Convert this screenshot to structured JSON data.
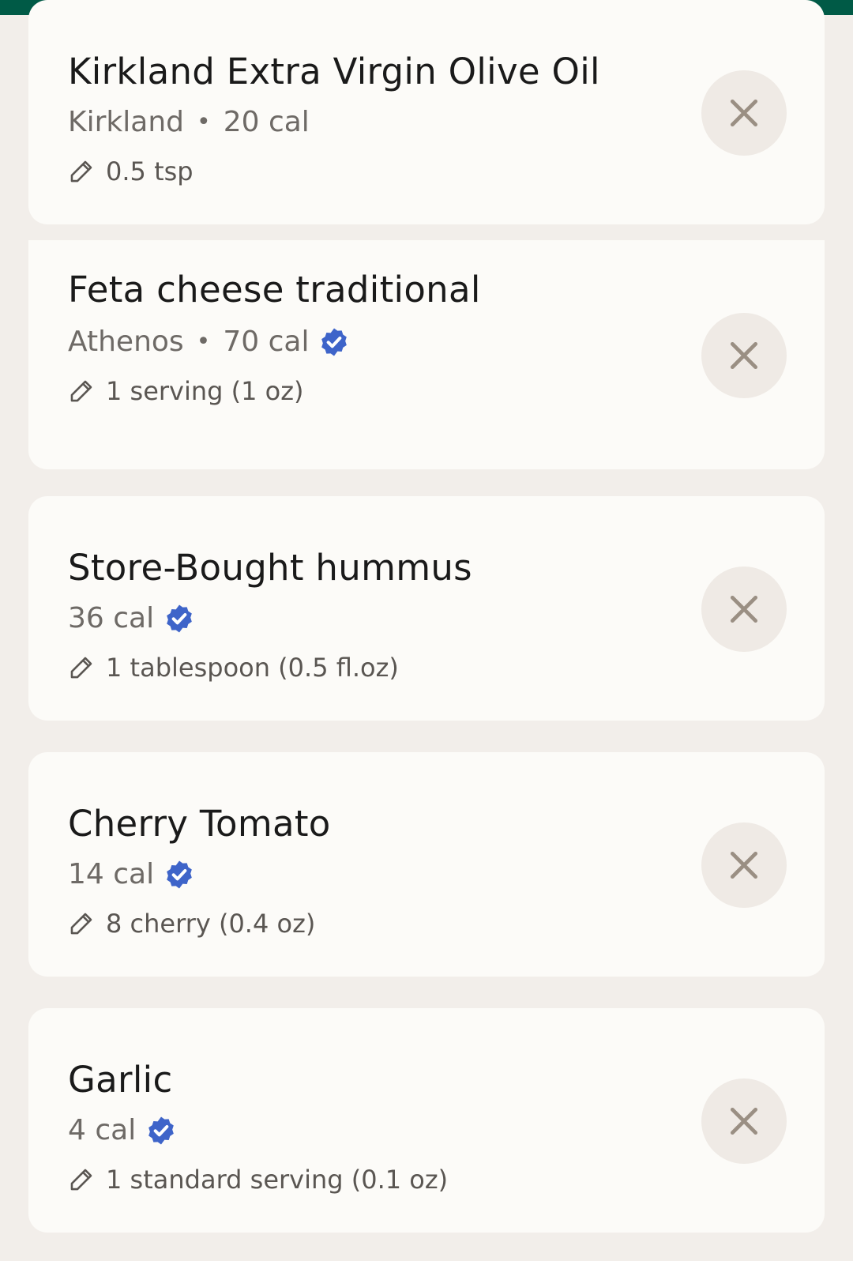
{
  "colors": {
    "top_bar": "#005a46",
    "background": "#f2eeea",
    "card": "#fcfbf8",
    "verified_badge": "#3e64c9",
    "remove_button": "#efeae5",
    "remove_icon": "#9a8f83"
  },
  "items": [
    {
      "name": "Feta cheese traditional",
      "brand": "Athenos",
      "calories": "70 cal",
      "verified": true,
      "serving": "1 serving (1 oz)",
      "edit_icon": "pencil-icon",
      "remove_icon": "close-icon"
    },
    {
      "name": "Store-Bought hummus",
      "brand": "",
      "calories": "36 cal",
      "verified": true,
      "serving": "1 tablespoon (0.5 fl.oz)",
      "edit_icon": "pencil-icon",
      "remove_icon": "close-icon"
    },
    {
      "name": "Cherry Tomato",
      "brand": "",
      "calories": "14 cal",
      "verified": true,
      "serving": "8 cherry (0.4 oz)",
      "edit_icon": "pencil-icon",
      "remove_icon": "close-icon"
    },
    {
      "name": "Garlic",
      "brand": "",
      "calories": "4 cal",
      "verified": true,
      "serving": "1 standard serving (0.1 oz)",
      "edit_icon": "pencil-icon",
      "remove_icon": "close-icon"
    },
    {
      "name": "Kirkland Extra Virgin Olive Oil",
      "brand": "Kirkland",
      "calories": "20 cal",
      "verified": false,
      "serving": "0.5 tsp",
      "edit_icon": "pencil-icon",
      "remove_icon": "close-icon"
    }
  ],
  "separator": "•"
}
